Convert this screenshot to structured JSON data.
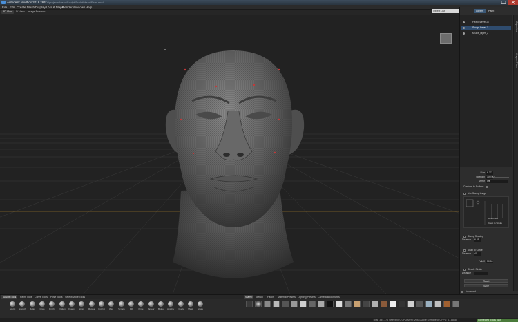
{
  "window": {
    "title": "Autodesk Mudbox 2016 x64",
    "path": "D:\\projects\\Head\\Sculpt\\Sculpt\\Head\\Final.mud"
  },
  "menu": [
    "File",
    "Edit",
    "Create",
    "Mesh",
    "Display",
    "UVs & Maps",
    "Render",
    "Windows",
    "Help"
  ],
  "view_tabs": [
    "3D View",
    "UV View",
    "Image Browser"
  ],
  "right_panel": {
    "search_placeholder": "Object List",
    "tabs": [
      "Layers",
      "Paint"
    ],
    "layers": [
      {
        "name": "Head (Level 2)",
        "selected": false
      },
      {
        "name": "Sculpt Layer 1",
        "selected": true
      },
      {
        "name": "sculpt_layer_2",
        "selected": false
      }
    ],
    "side_tabs": [
      "Object List",
      "Viewport Filters"
    ]
  },
  "properties": {
    "size_label": "Size",
    "size_value": "6.37",
    "strength_label": "Strength",
    "strength_value": "100.00",
    "mirror_label": "Mirror",
    "mirror_value": "Off",
    "conform_label": "Conform to Surface",
    "stamp_label": "Use Stamp Image",
    "randomize_label": "Randomize",
    "orient_label": "Orient to Stroke",
    "stamp_spacing_label": "Stamp Spacing",
    "distance_label": "Distance",
    "distance_value": "6.25",
    "snap_label": "Snap to Curve",
    "snap_distance_value": "40",
    "falloff_label": "Falloff",
    "falloff_value": "50.00",
    "steady_label": "Steady Stroke",
    "steady_distance_value": "",
    "reset_label": "Reset",
    "save_label": "Save",
    "advanced_label": "Advanced"
  },
  "tray_left_tabs": [
    "Sculpt Tools",
    "Paint Tools",
    "Curve Tools",
    "Pose Tools",
    "Select/Move Tools"
  ],
  "tools": [
    "Sculpt",
    "Smooth",
    "Relax",
    "Grab",
    "Pinch",
    "Flatten",
    "Foamy",
    "Spray",
    "Repeat",
    "Imprint",
    "Wax",
    "Scrape",
    "Fill",
    "Knife",
    "Smear",
    "Bulge",
    "Amplify",
    "Freeze",
    "Mask",
    "Erase"
  ],
  "tray_right_tabs": [
    "Stamp",
    "Stencil",
    "Falloff",
    "Material Presets",
    "Lighting Presets",
    "Camera Bookmarks"
  ],
  "status": {
    "left": "Total: 384,776   Selected: 0   GPU Mem: 2048   Active: 0   Highest: 0   FPS: 67.8868",
    "right": "Connected to 3ds Max"
  },
  "colors": {
    "viewport_bg": "#222222",
    "selection_blue": "#2f4c6e",
    "accent_green": "#4a7a3a"
  }
}
